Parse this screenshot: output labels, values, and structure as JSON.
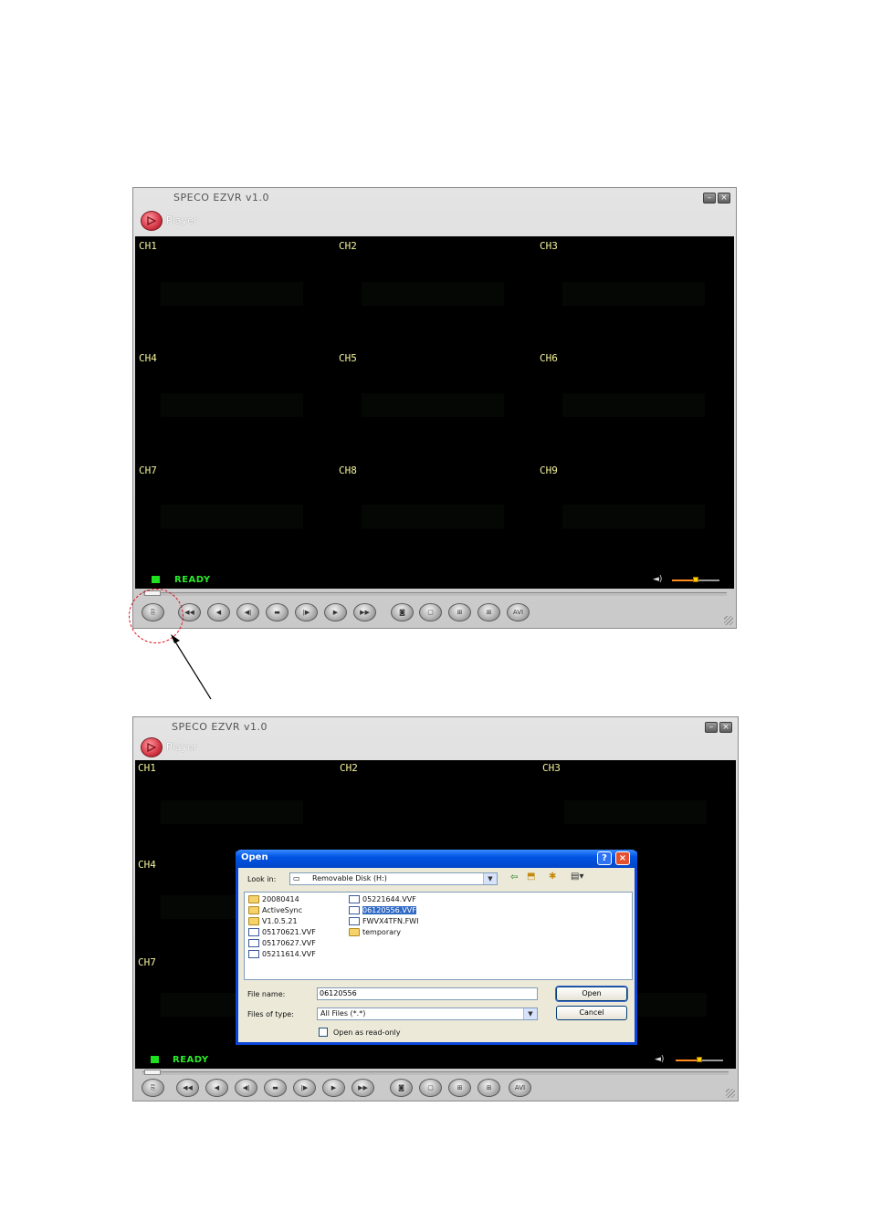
{
  "app_title": "SPECO EZVR v1.0",
  "mode_label": "Player",
  "minimize_glyph": "–",
  "close_glyph": "×",
  "channels": [
    "CH1",
    "CH2",
    "CH3",
    "CH4",
    "CH5",
    "CH6",
    "CH7",
    "CH8",
    "CH9"
  ],
  "status": "READY",
  "volume_icon": "◄)",
  "volume_level": 0.5,
  "controls": [
    "open-file",
    "rewind",
    "step-back",
    "slow-back",
    "pause",
    "slow-forward",
    "play",
    "fast-forward",
    "snapshot",
    "single-view",
    "quad-view",
    "nine-view",
    "avi"
  ],
  "controls_glyphs": [
    "⎘",
    "◀◀",
    "◀",
    "◀ǀ",
    "▬",
    "ǀ▶",
    "▶",
    "▶▶",
    "◙",
    "▢",
    "⊞",
    "⊞",
    "AVI"
  ],
  "open_dialog": {
    "title": "Open",
    "help_glyph": "?",
    "close_glyph": "×",
    "look_in_label": "Look in:",
    "look_in_value": "Removable Disk (H:)",
    "folders": [
      "20080414",
      "ActiveSync",
      "V1.0.5.21"
    ],
    "files_col1": [
      "05170621.VVF",
      "05170627.VVF",
      "05211614.VVF"
    ],
    "files_col2": [
      "05221644.VVF",
      "06120556.VVF",
      "FWVX4TFN.FWI"
    ],
    "folder_col2": "temporary",
    "selected_file": "06120556.VVF",
    "file_name_label": "File name:",
    "file_name_value": "06120556",
    "files_of_type_label": "Files of type:",
    "files_of_type_value": "All Files (*.*)",
    "open_button": "Open",
    "cancel_button": "Cancel",
    "read_only_label": "Open as read-only",
    "read_only_checked": false
  },
  "colors": {
    "channel_label": "#f3f29a",
    "status_green": "#2bea2b",
    "dialog_title_blue": "#0054e3",
    "annotation_red": "#e0121e"
  }
}
